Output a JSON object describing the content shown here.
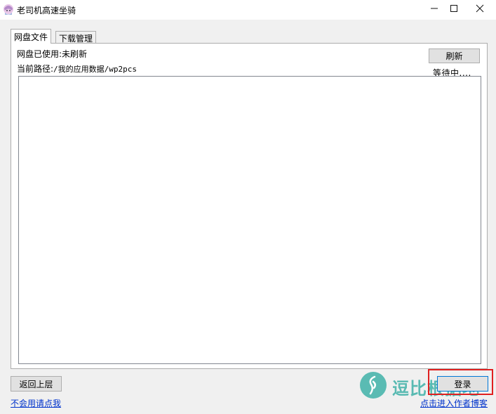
{
  "window": {
    "title": "老司机高速坐骑",
    "minimize": "—",
    "maximize": "☐",
    "close": "✕"
  },
  "tabs": [
    {
      "label": "网盘文件",
      "active": true
    },
    {
      "label": "下载管理",
      "active": false
    }
  ],
  "panel": {
    "usage": "网盘已使用:未刷新",
    "path_label": "当前路径:",
    "path_value": "/我的应用数据/wp2pcs",
    "refresh_button": "刷新",
    "status": "等待中....",
    "file_list": []
  },
  "footer": {
    "back_button": "返回上层",
    "login_button": "登录",
    "help_link": "不会用请点我",
    "blog_link": "点击进入作者博客"
  },
  "watermark": {
    "text": "逗比根据地"
  },
  "colors": {
    "link": "#0033cc",
    "highlight": "#e02020",
    "watermark": "#3fb1a8"
  },
  "icons": {
    "app": "anime-avatar-icon",
    "watermark_logo": "spiral-logo-icon"
  }
}
